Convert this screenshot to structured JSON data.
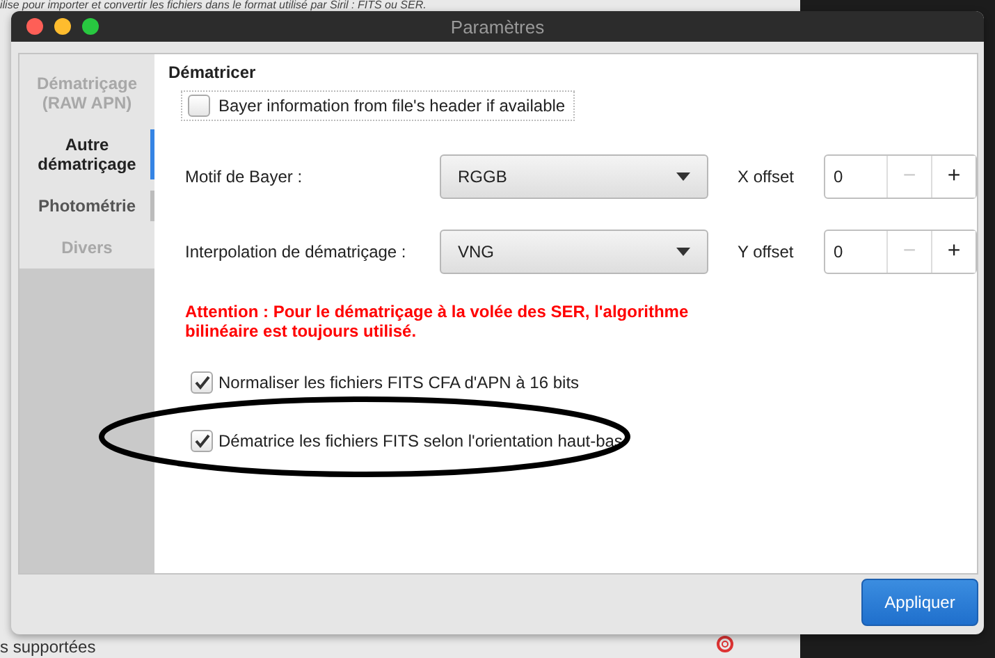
{
  "background": {
    "top_text": "ilise pour importer et convertir les fichiers dans le format utilisé par Siril : FITS ou SER.",
    "bottom_text": "s supportées"
  },
  "window": {
    "title": "Paramètres"
  },
  "sidebar": {
    "items": [
      {
        "label": "Dématriçage (RAW APN)",
        "selected": false,
        "disabled": true
      },
      {
        "label": "Autre dématriçage",
        "selected": true,
        "disabled": false
      },
      {
        "label": "Photométrie",
        "selected": false,
        "disabled": false
      },
      {
        "label": "Divers",
        "selected": false,
        "disabled": true
      }
    ]
  },
  "section": {
    "title": "Dématricer",
    "header_checkbox": {
      "label": "Bayer information from file's header if available",
      "checked": false
    },
    "rows": [
      {
        "label": "Motif de Bayer :",
        "dropdown": "RGGB",
        "offset_label": "X offset",
        "offset_value": "0",
        "minus": "−",
        "plus": "+"
      },
      {
        "label": "Interpolation de dématriçage :",
        "dropdown": "VNG",
        "offset_label": "Y offset",
        "offset_value": "0",
        "minus": "−",
        "plus": "+"
      }
    ],
    "warning": "Attention : Pour le dématriçage à la volée des SER, l'algorithme bilinéaire est toujours utilisé.",
    "options": [
      {
        "label": "Normaliser les fichiers FITS CFA d'APN à 16 bits",
        "checked": true
      },
      {
        "label": "Dématrice les fichiers FITS selon l'orientation haut-bas",
        "checked": true
      }
    ]
  },
  "annotation": {
    "kind": "ellipse"
  },
  "buttons": [
    {
      "label": "Appliquer"
    }
  ]
}
